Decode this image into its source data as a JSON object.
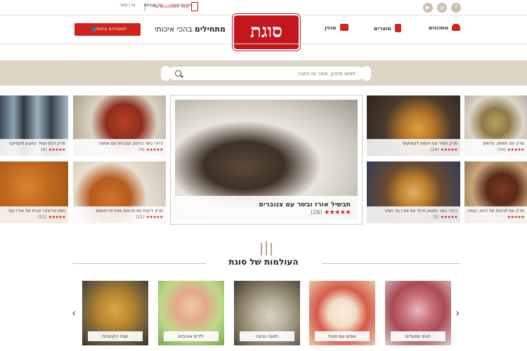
{
  "topbar": {
    "links": [
      "אודות סוגת",
      "About Us",
      "צרו קשר"
    ],
    "my_book": "ספר המתכונים שלי",
    "social": [
      "facebook-icon",
      "instagram-icon",
      "youtube-icon"
    ]
  },
  "header": {
    "logo": "סוגת",
    "tagline_bold": "מתחילים",
    "tagline_rest": " בהכי איכותי",
    "store_button": "למעוניינים בחנות",
    "nav": [
      "מתכונים",
      "מוצרים",
      "מגזין"
    ]
  },
  "search": {
    "placeholder": "חפשו מתכון, מוצר או כתבה"
  },
  "recipes": [
    {
      "title": "מרק דגים עשיר בסגנון מקסיקני",
      "rating": 5,
      "count": "(4)"
    },
    {
      "title": "כדורי בשר ברוטב עגבניות עם אפונה",
      "rating": 5,
      "count": "(4)"
    },
    {
      "title": "תבשיל אורז ובשר עם צנוברים",
      "rating": 5,
      "count": "(26)"
    },
    {
      "title": "מרק עשיר עם חומוס לקוסקוס",
      "rating": 5,
      "count": "(24)"
    },
    {
      "title": "מרק עם חומוס, עדשים",
      "rating": 5,
      "count": "(34)"
    },
    {
      "title": "חמין עיראקי: טבית של אורז עוף",
      "rating": 5,
      "count": "(21)"
    },
    {
      "title": "מרק ירקות עם עדשים שחורות וחומוס",
      "rating": 5,
      "count": "(21)"
    },
    {
      "title": "כדורי בשר בסגנון פרסי עם אורז גזר חגיגי",
      "rating": 5,
      "count": "(5)"
    },
    {
      "title": "מרק עם לביבות של דגים, קטניות",
      "rating": 5,
      "count": ""
    }
  ],
  "worlds": {
    "title": "העולמות של סוגת",
    "items": [
      "חגים ומועדים",
      "אפים עם סוגת",
      "תזונה נבונה",
      "ילדים אוהבים",
      "שנת הקטניות"
    ]
  },
  "colors": {
    "brand_red": "#c4161c",
    "band": "#ddd4c5"
  }
}
